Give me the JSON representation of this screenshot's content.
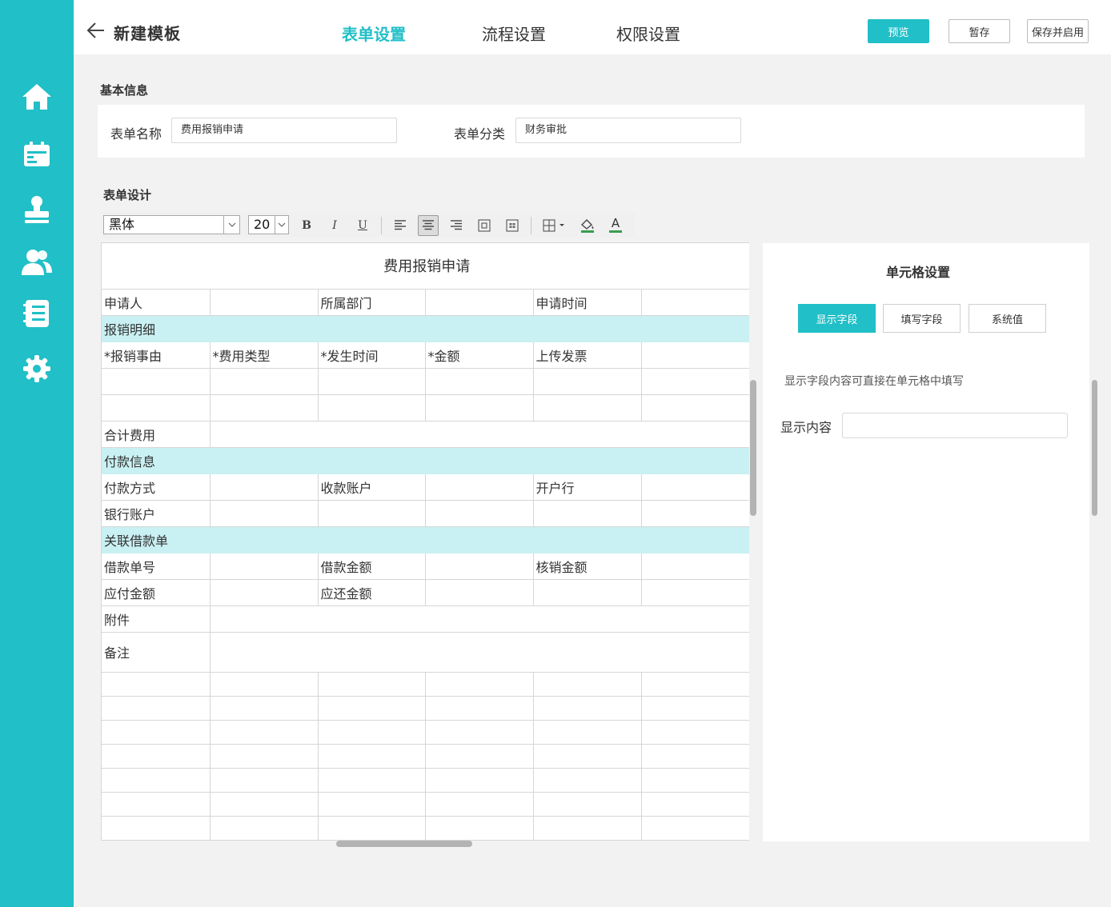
{
  "sidebar": {
    "items": [
      {
        "icon": "home-icon"
      },
      {
        "icon": "calendar-icon"
      },
      {
        "icon": "stamp-icon"
      },
      {
        "icon": "users-icon"
      },
      {
        "icon": "list-icon"
      },
      {
        "icon": "gear-icon"
      }
    ]
  },
  "header": {
    "title": "新建模板",
    "tabs": [
      "表单设置",
      "流程设置",
      "权限设置"
    ],
    "active_tab": "表单设置",
    "preview_label": "预览",
    "draft_label": "暂存",
    "save_enable_label": "保存并启用"
  },
  "basic_info": {
    "section_label": "基本信息",
    "form_name_label": "表单名称",
    "form_name_value": "费用报销申请",
    "category_label": "表单分类",
    "category_value": "财务审批"
  },
  "design": {
    "section_label": "表单设计",
    "toolbar": {
      "font_family": "黑体",
      "font_size": "20",
      "bold": "B",
      "italic": "I",
      "underline": "U",
      "font_color_glyph": "A"
    }
  },
  "form": {
    "title": "费用报销申请",
    "row_applicant": [
      "申请人",
      "",
      "所属部门",
      "",
      "申请时间",
      ""
    ],
    "section_detail": "报销明细",
    "detail_headers": [
      "*报销事由",
      "*费用类型",
      "*发生时间",
      "*金额",
      "上传发票",
      ""
    ],
    "total_label": "合计费用",
    "section_payment": "付款信息",
    "row_payment_1": [
      "付款方式",
      "",
      "收款账户",
      "",
      "开户行",
      ""
    ],
    "row_payment_2": [
      "银行账户",
      "",
      "",
      "",
      "",
      ""
    ],
    "section_loan": "关联借款单",
    "row_loan_1": [
      "借款单号",
      "",
      "借款金额",
      "",
      "核销金额",
      ""
    ],
    "row_loan_2": [
      "应付金额",
      "",
      "应还金额",
      "",
      "",
      ""
    ],
    "attachment_label": "附件",
    "remark_label": "备注"
  },
  "cell_settings": {
    "title": "单元格设置",
    "tabs": [
      "显示字段",
      "填写字段",
      "系统值"
    ],
    "active_tab": "显示字段",
    "hint": "显示字段内容可直接在单元格中填写",
    "content_label": "显示内容",
    "content_value": ""
  },
  "colors": {
    "accent": "#21bfc7",
    "section_fill": "#c9f0f2",
    "background": "#f2f2f2"
  }
}
